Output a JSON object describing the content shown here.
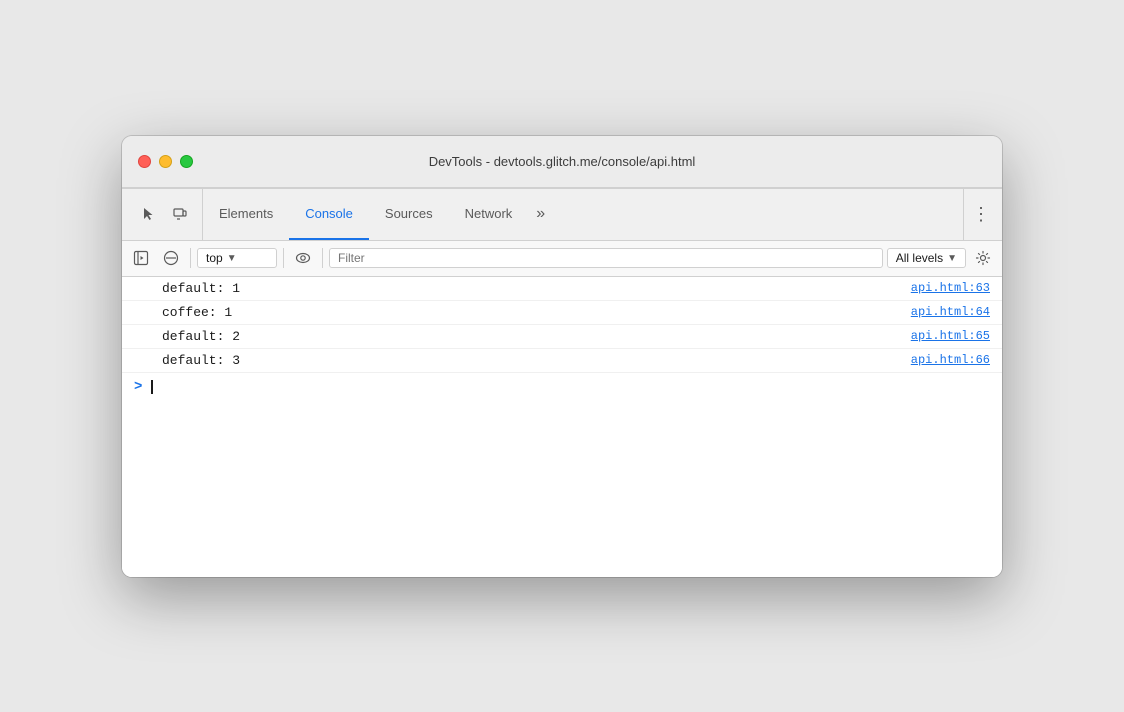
{
  "window": {
    "title": "DevTools - devtools.glitch.me/console/api.html"
  },
  "tabbar": {
    "icons": [
      {
        "name": "cursor-icon",
        "symbol": "↖"
      },
      {
        "name": "device-icon",
        "symbol": "⬜"
      }
    ],
    "tabs": [
      {
        "label": "Elements",
        "active": false
      },
      {
        "label": "Console",
        "active": true
      },
      {
        "label": "Sources",
        "active": false
      },
      {
        "label": "Network",
        "active": false
      }
    ],
    "overflow_label": "»",
    "more_label": "⋮"
  },
  "console_toolbar": {
    "sidebar_icon": "▶",
    "clear_icon": "⊘",
    "context_label": "top",
    "eye_icon": "👁",
    "filter_placeholder": "Filter",
    "levels_label": "All levels",
    "settings_icon": "⚙"
  },
  "console_rows": [
    {
      "text": "default: 1",
      "link": "api.html:63"
    },
    {
      "text": "coffee: 1",
      "link": "api.html:64"
    },
    {
      "text": "default: 2",
      "link": "api.html:65"
    },
    {
      "text": "default: 3",
      "link": "api.html:66"
    }
  ],
  "console_input": {
    "prompt": ">"
  },
  "colors": {
    "active_tab": "#1a73e8",
    "link": "#1a73e8"
  }
}
